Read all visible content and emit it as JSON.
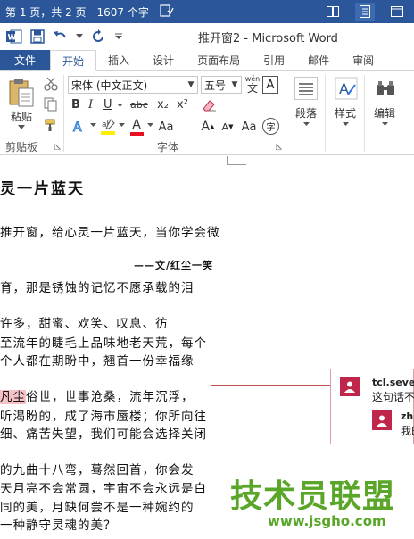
{
  "status_bar": {
    "page_info": "第 1 页，共 2 页",
    "word_count": "1607 个字",
    "colors": {
      "background": "#2b579a",
      "text": "#ffffff"
    }
  },
  "title_bar": {
    "title": "推开窗2 - Microsoft Word"
  },
  "tabs": [
    {
      "label": "文件"
    },
    {
      "label": "开始"
    },
    {
      "label": "插入"
    },
    {
      "label": "设计"
    },
    {
      "label": "页面布局"
    },
    {
      "label": "引用"
    },
    {
      "label": "邮件"
    },
    {
      "label": "审阅"
    }
  ],
  "ribbon": {
    "clipboard": {
      "paste_label": "粘贴",
      "group_label": "剪贴板"
    },
    "font": {
      "font_name": "宋体 (中文正文)",
      "font_size": "五号",
      "wen_label": "wén",
      "wen_char": "文",
      "group_label": "字体",
      "bold": "B",
      "italic": "I",
      "underline": "U",
      "strike": "abc",
      "subscript": "x₂",
      "superscript": "x²",
      "font_color_glyph": "A",
      "grow_glyph": "A",
      "shrink_glyph": "A",
      "aa_glyph": "Aa",
      "char_border": "A",
      "enclose_char": "字"
    },
    "paragraph": {
      "label": "段落"
    },
    "styles": {
      "label": "样式"
    },
    "editing": {
      "label": "编辑"
    }
  },
  "document": {
    "lines": [
      {
        "text": "灵一片蓝天"
      },
      {
        "text": "推开窗，给心灵一片蓝天，当你学会微"
      },
      {
        "text": "——文/红尘一笑"
      },
      {
        "text": "育，那是锈蚀的记忆不愿承载的泪"
      },
      {
        "text": "许多，甜蜜、欢笑、叹息、彷"
      },
      {
        "text": "至流年的睫毛上品味地老天荒，每个"
      },
      {
        "text": "个人都在期盼中，翘首一份幸福缘"
      },
      {
        "pre": "",
        "highlight": "凡尘",
        "post": "俗世，世事沧桑，流年沉浮，"
      },
      {
        "text": "听渴盼的，成了海市蜃楼；你所向往"
      },
      {
        "text": "细、痛苦失望，我们可能会选择关闭"
      },
      {
        "text": "的九曲十八弯，蓦然回首，你会发"
      },
      {
        "text": "天月亮不会常圆，宇宙不会永远是白"
      },
      {
        "text": "同的美，月缺何尝不是一种婉约的"
      },
      {
        "text": "一种静守灵魂的美？"
      }
    ],
    "highlight_color": "#f5c2c7"
  },
  "comments": [
    {
      "author": "tcl.sever",
      "text": "这句话不"
    },
    {
      "author": "zh",
      "text": "我的"
    }
  ],
  "watermark": {
    "logo_text": "技术员联盟",
    "url": "www.jsgho.com",
    "color": "#5aa629"
  }
}
